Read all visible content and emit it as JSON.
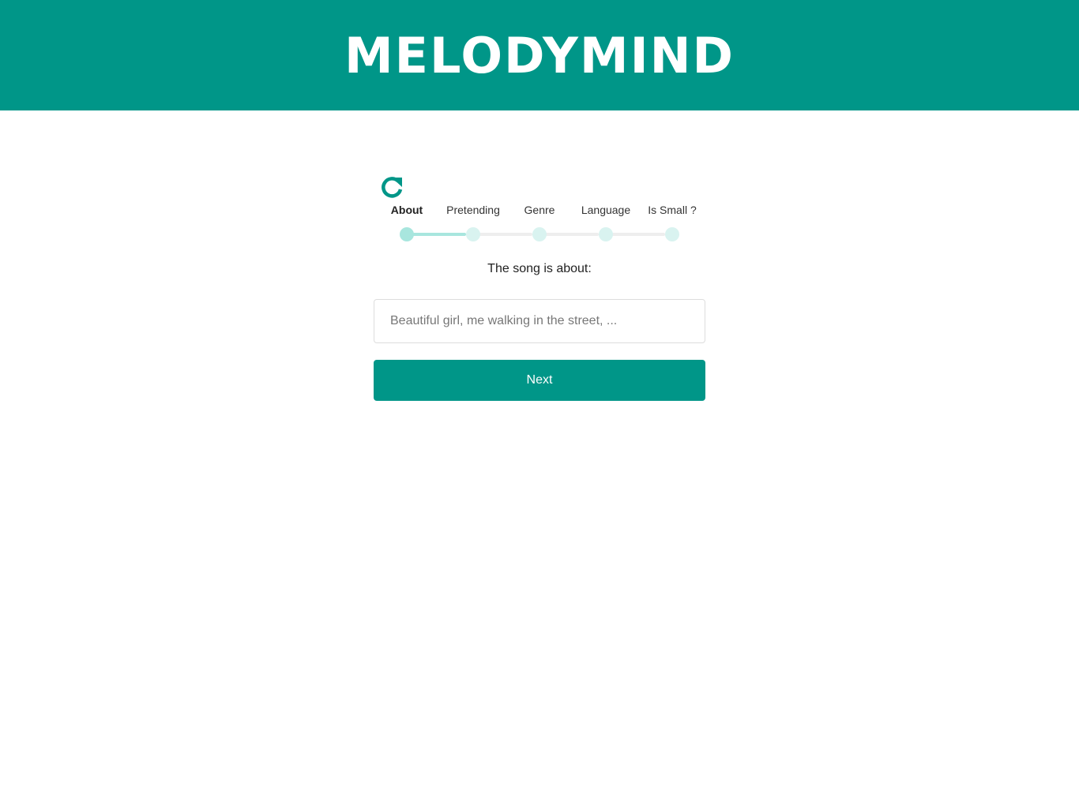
{
  "app": {
    "title": "MELODYMIND",
    "accent_color": "#009688"
  },
  "wizard": {
    "reset_icon": "refresh-icon",
    "steps": [
      {
        "label": "About",
        "active": true
      },
      {
        "label": "Pretending",
        "active": false
      },
      {
        "label": "Genre",
        "active": false
      },
      {
        "label": "Language",
        "active": false
      },
      {
        "label": "Is Small ?",
        "active": false
      }
    ],
    "question": "The song is about:",
    "input": {
      "value": "",
      "placeholder": "Beautiful girl, me walking in the street, ..."
    },
    "next_label": "Next"
  }
}
